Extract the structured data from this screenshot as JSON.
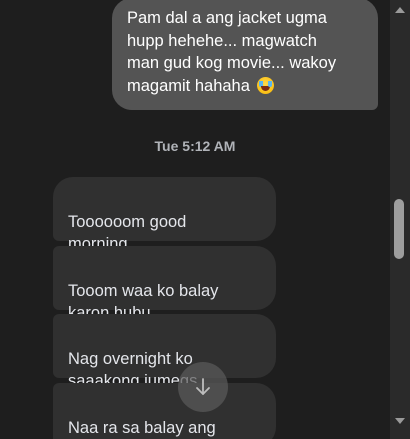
{
  "conversation": {
    "outgoing": [
      {
        "text": "Pam dal a ang jacket ugma\nhupp hehehe... magwatch\nman gud kog movie... wakoy\nmagamit hahaha",
        "emoji": "face-with-tears-of-joy"
      }
    ],
    "timestamp": "Tue 5:12 AM",
    "incoming": [
      {
        "text": "Toooooom good\nmorning"
      },
      {
        "text": "Tooom waa ko balay\nkaron hubu"
      },
      {
        "text": "Nag overnight ko\nsaaakong jumegs"
      },
      {
        "text": "Naa ra sa balay ang\nhacket"
      }
    ]
  },
  "controls": {
    "scroll_down_icon": "arrow-down-icon"
  },
  "colors": {
    "background": "#1e1e1e",
    "outgoing_bubble": "#545454",
    "incoming_bubble": "#303030",
    "text": "#e4e6eb",
    "timestamp": "#b0b3b8"
  }
}
